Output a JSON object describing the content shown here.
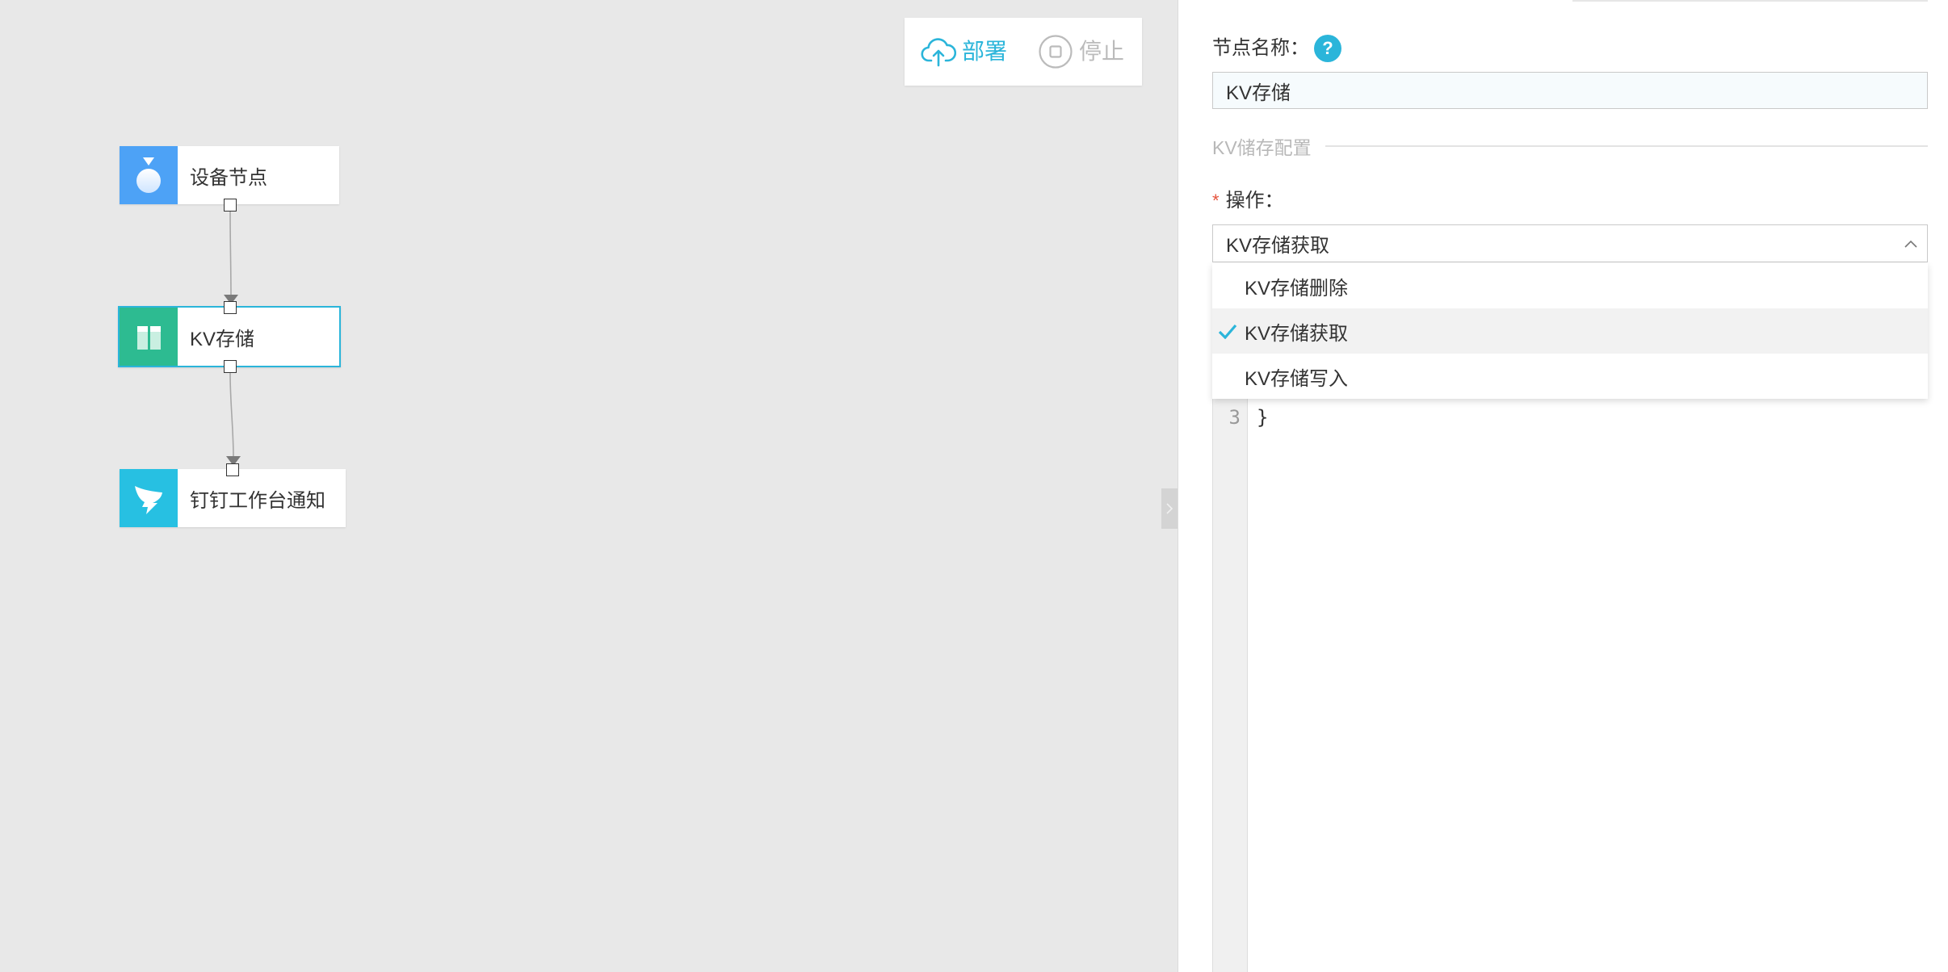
{
  "toolbar": {
    "deploy": {
      "label": "部署",
      "icon": "cloud-upload-icon"
    },
    "stop": {
      "label": "停止",
      "icon": "stop-icon",
      "disabled": true
    }
  },
  "canvas": {
    "nodes": [
      {
        "label": "设备节点",
        "icon": "device-icon",
        "color": "#4da2f6",
        "selected": false
      },
      {
        "label": "KV存储",
        "icon": "kv-storage-icon",
        "color": "#2dbb91",
        "selected": true
      },
      {
        "label": "钉钉工作台通知",
        "icon": "dingtalk-icon",
        "color": "#27c0e2",
        "selected": false
      }
    ],
    "collapse_handle_icon": "chevron-right-icon"
  },
  "panel": {
    "node_name": {
      "label": "节点名称：",
      "help": "?",
      "value": "KV存储"
    },
    "section_title": "KV储存配置",
    "operation": {
      "required_mark": "*",
      "label": "操作：",
      "value": "KV存储获取",
      "open": true,
      "options": [
        {
          "label": "KV存储删除",
          "selected": false
        },
        {
          "label": "KV存储获取",
          "selected": true
        },
        {
          "label": "KV存储写入",
          "selected": false
        }
      ]
    },
    "editor": {
      "visible_lines": [
        {
          "number": "3",
          "text": "}"
        }
      ]
    }
  },
  "colors": {
    "accent": "#2bb5da",
    "canvas_background": "#e8e8e8",
    "required": "#e5533d",
    "disabled": "#bbbbbb"
  }
}
